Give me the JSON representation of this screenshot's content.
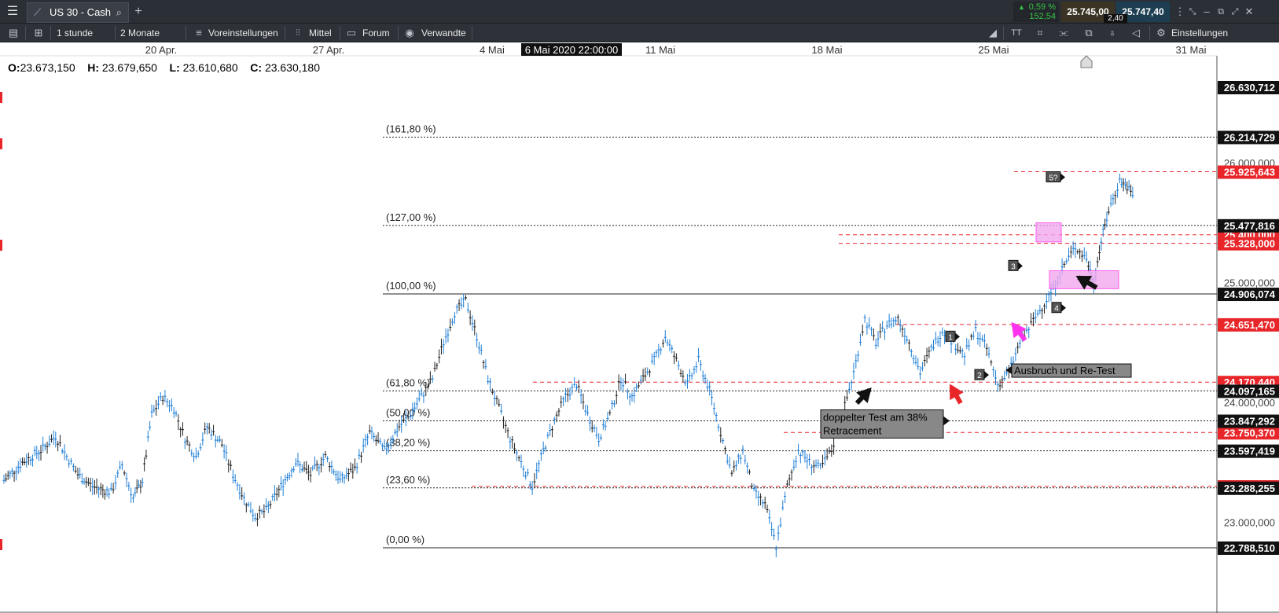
{
  "window": {
    "tab_title": "US 30 - Cash",
    "change_pct": "0,59 %",
    "change_abs": "152,54",
    "bid": "25.745,00",
    "ask": "25.747,40",
    "spread": "2,40"
  },
  "toolbar": {
    "timeframe": "1 stunde",
    "range": "2 Monate",
    "presets": "Voreinstellungen",
    "indicator": "Mittel",
    "forum": "Forum",
    "related": "Verwandte",
    "settings": "Einstellungen"
  },
  "ohlc": {
    "o_label": "O:",
    "o": "23.673,150",
    "h_label": "H:",
    "h": "23.679,650",
    "l_label": "L:",
    "l": "23.610,680",
    "c_label": "C:",
    "c": "23.630,180"
  },
  "colors": {
    "candle": "#1f7fd6",
    "candle_dark": "#222222",
    "fib_line": "#222222",
    "red_line": "#e8262a",
    "annotation_pink": "#ff33ee",
    "box_fill": "#f2a8ee",
    "label_black": "#111111",
    "label_red": "#e8262a",
    "toolbar_bg": "#2e3238"
  },
  "chart_data": {
    "type": "candlestick",
    "title": "US 30 - Cash",
    "x_ticks": [
      "20 Apr.",
      "27 Apr.",
      "4 Mai",
      "11 Mai",
      "18 Mai",
      "25 Mai",
      "31 Mai"
    ],
    "crosshair_date": "6 Mai 2020 22:00:00",
    "y_range": [
      22700,
      26700
    ],
    "y_ticks": [
      "26.000,000",
      "25.000,000",
      "24.000,000",
      "23.000,000"
    ],
    "fibonacci_levels": [
      {
        "label": "(161,80 %)",
        "value": 26214.729,
        "value_label": "26.214,729"
      },
      {
        "label": "(127,00 %)",
        "value": 25477.816,
        "value_label": "25.477,816"
      },
      {
        "label": "(100,00 %)",
        "value": 24906.074,
        "value_label": "24.906,074"
      },
      {
        "label": "(61,80 %)",
        "value": 24097.165,
        "value_label": "24.097,165"
      },
      {
        "label": "(50,00 %)",
        "value": 23847.292,
        "value_label": "23.847,292"
      },
      {
        "label": "(38,20 %)",
        "value": 23597.419,
        "value_label": "23.597,419"
      },
      {
        "label": "(23,60 %)",
        "value": 23288.255,
        "value_label": "23.288,255"
      },
      {
        "label": "(0,00 %)",
        "value": 22788.51,
        "value_label": "22.788,510"
      }
    ],
    "horizontal_lines": [
      {
        "value": 25925.643,
        "label": "25.925,643"
      },
      {
        "value": 25400,
        "label": "25.400,000"
      },
      {
        "value": 25328.0,
        "label": "25.328,000"
      },
      {
        "value": 24651.47,
        "label": "24.651,470"
      },
      {
        "value": 24170.44,
        "label": "24.170,440"
      },
      {
        "value": 23750.37,
        "label": "23.750,370"
      },
      {
        "value": 23300,
        "label": "23.300,000"
      }
    ],
    "current_price": {
      "value": 26630.712,
      "label": "26.630,712"
    },
    "wave_labels": [
      "1",
      "2",
      "3",
      "4",
      "5?"
    ],
    "annotations": [
      {
        "text": "doppelter Test am 38% Retracement"
      },
      {
        "text": "Ausbruch und Re-Test"
      }
    ],
    "path_points": [
      [
        0,
        23350
      ],
      [
        10,
        23500
      ],
      [
        20,
        23600
      ],
      [
        28,
        23720
      ],
      [
        34,
        23550
      ],
      [
        40,
        23400
      ],
      [
        48,
        23300
      ],
      [
        58,
        23250
      ],
      [
        64,
        23480
      ],
      [
        70,
        23200
      ],
      [
        75,
        23350
      ],
      [
        80,
        23900
      ],
      [
        86,
        24050
      ],
      [
        92,
        23950
      ],
      [
        98,
        23700
      ],
      [
        104,
        23550
      ],
      [
        110,
        23800
      ],
      [
        118,
        23650
      ],
      [
        124,
        23400
      ],
      [
        130,
        23200
      ],
      [
        136,
        23050
      ],
      [
        142,
        23100
      ],
      [
        150,
        23300
      ],
      [
        158,
        23500
      ],
      [
        166,
        23400
      ],
      [
        174,
        23550
      ],
      [
        182,
        23350
      ],
      [
        190,
        23450
      ],
      [
        198,
        23750
      ],
      [
        206,
        23600
      ],
      [
        214,
        23800
      ],
      [
        220,
        23900
      ],
      [
        226,
        24050
      ],
      [
        232,
        24200
      ],
      [
        238,
        24500
      ],
      [
        244,
        24750
      ],
      [
        250,
        24850
      ],
      [
        256,
        24550
      ],
      [
        262,
        24200
      ],
      [
        268,
        23950
      ],
      [
        274,
        23700
      ],
      [
        280,
        23500
      ],
      [
        286,
        23300
      ],
      [
        292,
        23600
      ],
      [
        298,
        23850
      ],
      [
        304,
        24050
      ],
      [
        310,
        24150
      ],
      [
        316,
        23900
      ],
      [
        322,
        23700
      ],
      [
        328,
        23900
      ],
      [
        334,
        24200
      ],
      [
        340,
        24050
      ],
      [
        346,
        24200
      ],
      [
        352,
        24350
      ],
      [
        358,
        24550
      ],
      [
        364,
        24350
      ],
      [
        370,
        24150
      ],
      [
        376,
        24350
      ],
      [
        382,
        24100
      ],
      [
        388,
        23750
      ],
      [
        394,
        23400
      ],
      [
        400,
        23600
      ],
      [
        406,
        23250
      ],
      [
        412,
        23150
      ],
      [
        418,
        22800
      ],
      [
        424,
        23300
      ],
      [
        430,
        23600
      ],
      [
        436,
        23500
      ],
      [
        442,
        23450
      ],
      [
        448,
        23600
      ],
      [
        454,
        23900
      ],
      [
        460,
        24250
      ],
      [
        466,
        24700
      ],
      [
        472,
        24500
      ],
      [
        478,
        24650
      ],
      [
        484,
        24700
      ],
      [
        490,
        24500
      ],
      [
        496,
        24250
      ],
      [
        502,
        24450
      ],
      [
        508,
        24600
      ],
      [
        514,
        24500
      ],
      [
        520,
        24400
      ],
      [
        526,
        24600
      ],
      [
        532,
        24450
      ],
      [
        538,
        24150
      ],
      [
        544,
        24250
      ],
      [
        550,
        24500
      ],
      [
        556,
        24650
      ],
      [
        562,
        24800
      ],
      [
        568,
        24950
      ],
      [
        574,
        25150
      ],
      [
        580,
        25300
      ],
      [
        586,
        25200
      ],
      [
        590,
        25000
      ],
      [
        594,
        25350
      ],
      [
        598,
        25600
      ],
      [
        604,
        25850
      ],
      [
        608,
        25800
      ],
      [
        612,
        25700
      ]
    ]
  }
}
